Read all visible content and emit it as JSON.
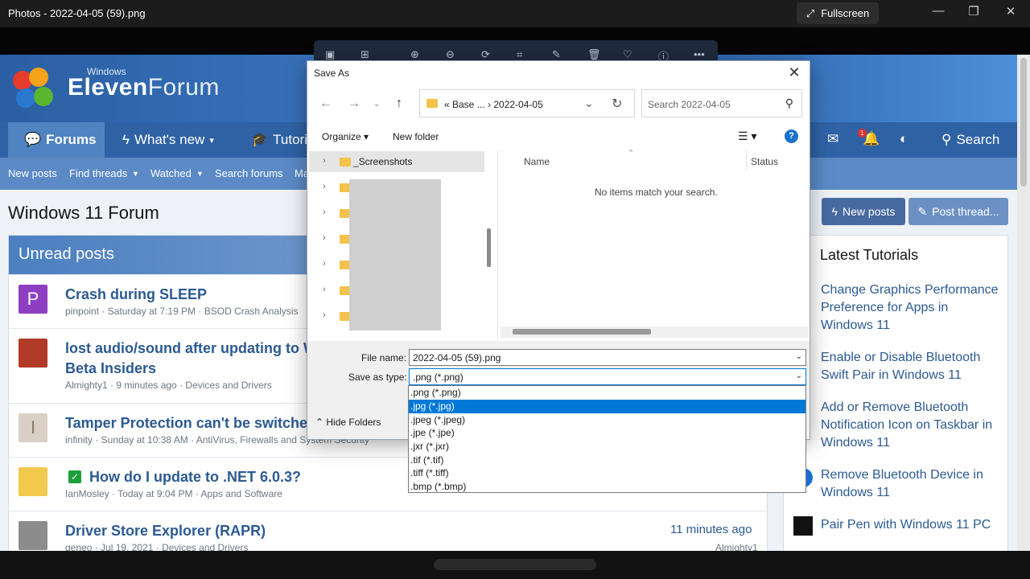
{
  "photos": {
    "title": "Photos - 2022-04-05 (59).png",
    "fullscreen_label": "Fullscreen"
  },
  "forum": {
    "logo_small": "Windows",
    "logo_big_a": "Eleven",
    "logo_big_b": "Forum",
    "nav": {
      "forums": "Forums",
      "whats_new": "What's new",
      "tutorials": "Tutori",
      "search": "Search",
      "alert_count": "1"
    },
    "subnav": [
      "New posts",
      "Find threads",
      "Watched",
      "Search forums",
      "Ma"
    ],
    "page_title": "Windows 11 Forum",
    "unread_heading": "Unread posts",
    "threads": [
      {
        "avatar": "P",
        "title": "Crash during SLEEP",
        "meta": "pinpoint · Saturday at 7:19 PM · BSOD Crash Analysis"
      },
      {
        "avatar": "",
        "title": "lost audio/sound after updating to W",
        "title2": "Beta Insiders",
        "meta": "Almighty1 · 9 minutes ago · Devices and Drivers"
      },
      {
        "avatar": "I",
        "title": "Tamper Protection can't be switched",
        "meta": "infinity · Sunday at 10:38 AM · AntiVirus, Firewalls and System Security"
      },
      {
        "avatar": "",
        "title": "How do I update to .NET 6.0.3?",
        "meta": "IanMosley · Today at 9:04 PM · Apps and Software"
      },
      {
        "avatar": "",
        "title": "Driver Store Explorer (RAPR)",
        "meta": "geneo · Jul 19, 2021 · Devices and Drivers",
        "when": "11 minutes ago",
        "who": "Almighty1"
      }
    ],
    "new_posts_btn": "New posts",
    "post_thread_btn": "Post thread...",
    "latest_heading": "Latest Tutorials",
    "tutorials": [
      "Change Graphics Performance Preference for Apps in Windows 11",
      "Enable or Disable Bluetooth Swift Pair in Windows 11",
      "Add or Remove Bluetooth Notification Icon on Taskbar in Windows 11",
      "Remove Bluetooth Device in Windows 11",
      "Pair Pen with Windows 11 PC"
    ]
  },
  "dialog": {
    "title": "Save As",
    "breadcrumb": "«  Base ...  ›  2022-04-05",
    "search_placeholder": "Search 2022-04-05",
    "organize": "Organize ▾",
    "new_folder": "New folder",
    "tree_first": "_Screenshots",
    "col_name": "Name",
    "col_status": "Status",
    "empty_message": "No items match your search.",
    "file_name_label": "File name:",
    "file_name_value": "2022-04-05 (59).png",
    "save_type_label": "Save as type:",
    "save_type_value": ".png (*.png)",
    "hide_folders": "Hide Folders",
    "type_options": [
      ".png (*.png)",
      ".jpg (*.jpg)",
      ".jpeg (*.jpeg)",
      ".jpe (*.jpe)",
      ".jxr (*.jxr)",
      ".tif (*.tif)",
      ".tiff (*.tiff)",
      ".bmp (*.bmp)"
    ],
    "highlighted_option_index": 1
  }
}
